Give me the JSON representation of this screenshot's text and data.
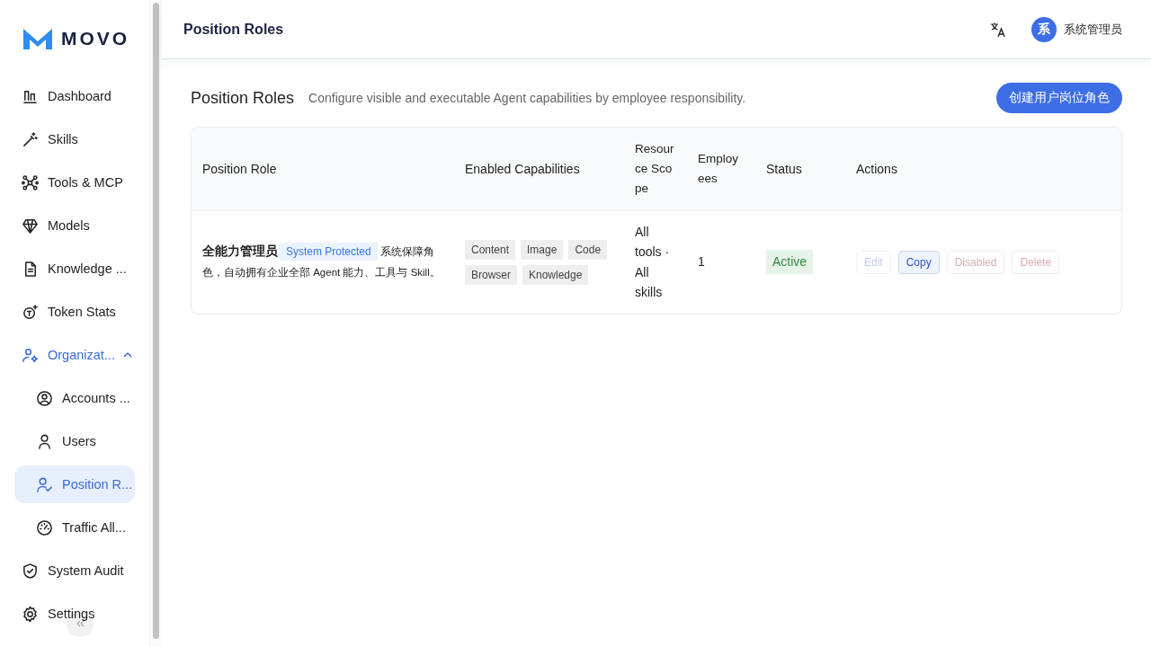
{
  "brand": {
    "name": "MOVO"
  },
  "sidebar": {
    "items": [
      {
        "label": "Dashboard",
        "selected": false
      },
      {
        "label": "Skills",
        "selected": false
      },
      {
        "label": "Tools & MCP",
        "selected": false
      },
      {
        "label": "Models",
        "selected": false
      },
      {
        "label": "Knowledge ...",
        "selected": false
      },
      {
        "label": "Token Stats",
        "selected": false
      },
      {
        "label": "Organizat...",
        "selected": false,
        "expanded": true,
        "children": [
          {
            "label": "Accounts ...",
            "selected": false
          },
          {
            "label": "Users",
            "selected": false
          },
          {
            "label": "Position R...",
            "selected": true
          },
          {
            "label": "Traffic All...",
            "selected": false
          }
        ]
      },
      {
        "label": "System Audit",
        "selected": false
      },
      {
        "label": "Settings",
        "selected": false
      }
    ]
  },
  "header": {
    "title": "Position Roles",
    "user": {
      "avatar": "系",
      "name": "系统管理员"
    }
  },
  "page": {
    "title": "Position Roles",
    "subtitle": "Configure visible and executable Agent capabilities by employee responsibility.",
    "create_button": "创建用户岗位角色"
  },
  "table": {
    "columns": [
      "Position Role",
      "Enabled Capabilities",
      "Resource Scope",
      "Employees",
      "Status",
      "Actions"
    ],
    "rows": [
      {
        "name": "全能力管理员",
        "badge": "System Protected",
        "description": "系统保障角色，自动拥有企业全部 Agent 能力、工具与 Skill。",
        "capabilities": [
          "Content",
          "Image",
          "Code",
          "Browser",
          "Knowledge"
        ],
        "scope": "All tools · All skills",
        "employees": "1",
        "status": {
          "label": "Active",
          "kind": "active"
        },
        "actions": [
          {
            "label": "Edit",
            "kind": "primary",
            "disabled": true
          },
          {
            "label": "Copy",
            "kind": "primary",
            "disabled": false
          },
          {
            "label": "Disabled",
            "kind": "danger",
            "disabled": true
          },
          {
            "label": "Delete",
            "kind": "danger",
            "disabled": true
          }
        ]
      }
    ]
  }
}
